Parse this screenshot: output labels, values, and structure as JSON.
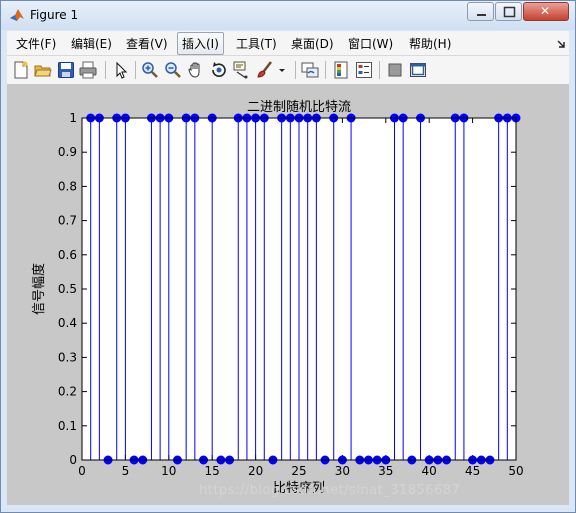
{
  "window": {
    "title": "Figure 1",
    "close_symbol": "✕"
  },
  "menu": {
    "items": [
      "文件(F)",
      "编辑(E)",
      "查看(V)",
      "插入(I)",
      "工具(T)",
      "桌面(D)",
      "窗口(W)",
      "帮助(H)"
    ],
    "active_index": 3
  },
  "toolbar": {
    "icons": [
      "new-figure-icon",
      "open-file-icon",
      "save-icon",
      "print-icon",
      "edit-plot-arrow-icon",
      "zoom-in-icon",
      "zoom-out-icon",
      "pan-hand-icon",
      "rotate-3d-icon",
      "data-cursor-icon",
      "brush-icon",
      "link-plot-icon",
      "colorbar-icon",
      "legend-icon",
      "hide-plot-tools-icon",
      "show-plot-tools-icon"
    ]
  },
  "watermark": "https://blog.csdn.net/sinat_31856687",
  "colors": {
    "stem": "#0000ff",
    "figure_bg": "#c8c8c8",
    "axes_bg": "#ffffff"
  },
  "chart_data": {
    "type": "stem",
    "title": "二进制随机比特流",
    "xlabel": "比特序列",
    "ylabel": "信号幅度",
    "xlim": [
      0,
      50
    ],
    "ylim": [
      0,
      1
    ],
    "grid": false,
    "xticks": [
      0,
      5,
      10,
      15,
      20,
      25,
      30,
      35,
      40,
      45,
      50
    ],
    "yticks": [
      "0",
      "0.1",
      "0.2",
      "0.3",
      "0.4",
      "0.5",
      "0.6",
      "0.7",
      "0.8",
      "0.9",
      "1"
    ],
    "series": [
      {
        "x": [
          1,
          2,
          3,
          4,
          5,
          6,
          7,
          8,
          9,
          10,
          11,
          12,
          13,
          14,
          15,
          16,
          17,
          18,
          19,
          20,
          21,
          22,
          23,
          24,
          25,
          26,
          27,
          28,
          29,
          30,
          31,
          32,
          33,
          34,
          35,
          36,
          37,
          38,
          39,
          40,
          41,
          42,
          43,
          44,
          45,
          46,
          47,
          48,
          49,
          50
        ],
        "values": [
          1,
          1,
          0,
          1,
          1,
          0,
          0,
          1,
          1,
          1,
          0,
          1,
          1,
          0,
          1,
          0,
          0,
          1,
          1,
          1,
          1,
          0,
          1,
          1,
          1,
          1,
          1,
          0,
          1,
          0,
          1,
          0,
          0,
          0,
          0,
          1,
          1,
          0,
          1,
          0,
          0,
          0,
          1,
          1,
          0,
          0,
          0,
          1,
          1,
          1
        ]
      }
    ]
  }
}
